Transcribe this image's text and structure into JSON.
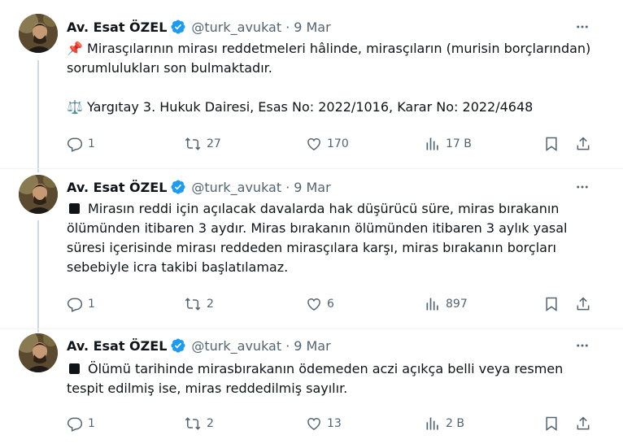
{
  "tweets": [
    {
      "name": "Av. Esat ÖZEL",
      "handle": "@turk_avukat",
      "separator": "·",
      "date": "9 Mar",
      "line1_emoji": "📌",
      "line1": "Mirasçılarının mirası reddetmeleri hâlinde, mirasçıların (murisin borçlarından) sorumlulukları son bulmaktadır.",
      "line2_emoji": "⚖️",
      "line2": "Yargıtay  3. Hukuk Dairesi, Esas No: 2022/1016, Karar No: 2022/4648",
      "replies": "1",
      "reposts": "27",
      "likes": "170",
      "views": "17 B"
    },
    {
      "name": "Av. Esat ÖZEL",
      "handle": "@turk_avukat",
      "separator": "·",
      "date": "9 Mar",
      "text": "Mirasın reddi için açılacak davalarda hak düşürücü süre, miras bırakanın ölümünden itibaren 3 aydır. Miras bırakanın ölümünden itibaren 3 aylık yasal süresi içerisinde mirası reddeden mirasçılara karşı, miras bırakanın borçları sebebiyle icra takibi başlatılamaz.",
      "replies": "1",
      "reposts": "2",
      "likes": "6",
      "views": "897"
    },
    {
      "name": "Av. Esat ÖZEL",
      "handle": "@turk_avukat",
      "separator": "·",
      "date": "9 Mar",
      "text": "Ölümü tarihinde mirasbırakanın ödemeden aczi açıkça belli veya resmen tespit edilmiş ise, miras reddedilmiş sayılır.",
      "replies": "1",
      "reposts": "2",
      "likes": "13",
      "views": "2 B"
    }
  ],
  "icons": {
    "verified": "verified-badge-icon",
    "more": "more-icon",
    "reply": "reply-icon",
    "repost": "repost-icon",
    "like": "heart-icon",
    "views": "views-icon",
    "bookmark": "bookmark-icon",
    "share": "share-icon"
  },
  "colors": {
    "accent": "#1d9bf0",
    "muted": "#536471",
    "text": "#0f1419"
  }
}
